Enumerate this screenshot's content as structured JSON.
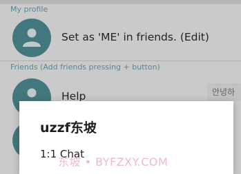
{
  "profile_section": {
    "header": "My profile",
    "row_title": "Set as 'ME' in friends. (Edit)"
  },
  "friends_section": {
    "header": "Friends (Add friends pressing + button)",
    "items": [
      {
        "title": "Help",
        "tag": "안녕하"
      }
    ]
  },
  "dialog": {
    "title": "uzzf东坡",
    "items": [
      "1:1 Chat"
    ]
  },
  "watermark": "东坡 • BYFZXY.COM",
  "colors": {
    "avatar": "#4f8f96",
    "section_header": "#6aa1ad"
  }
}
